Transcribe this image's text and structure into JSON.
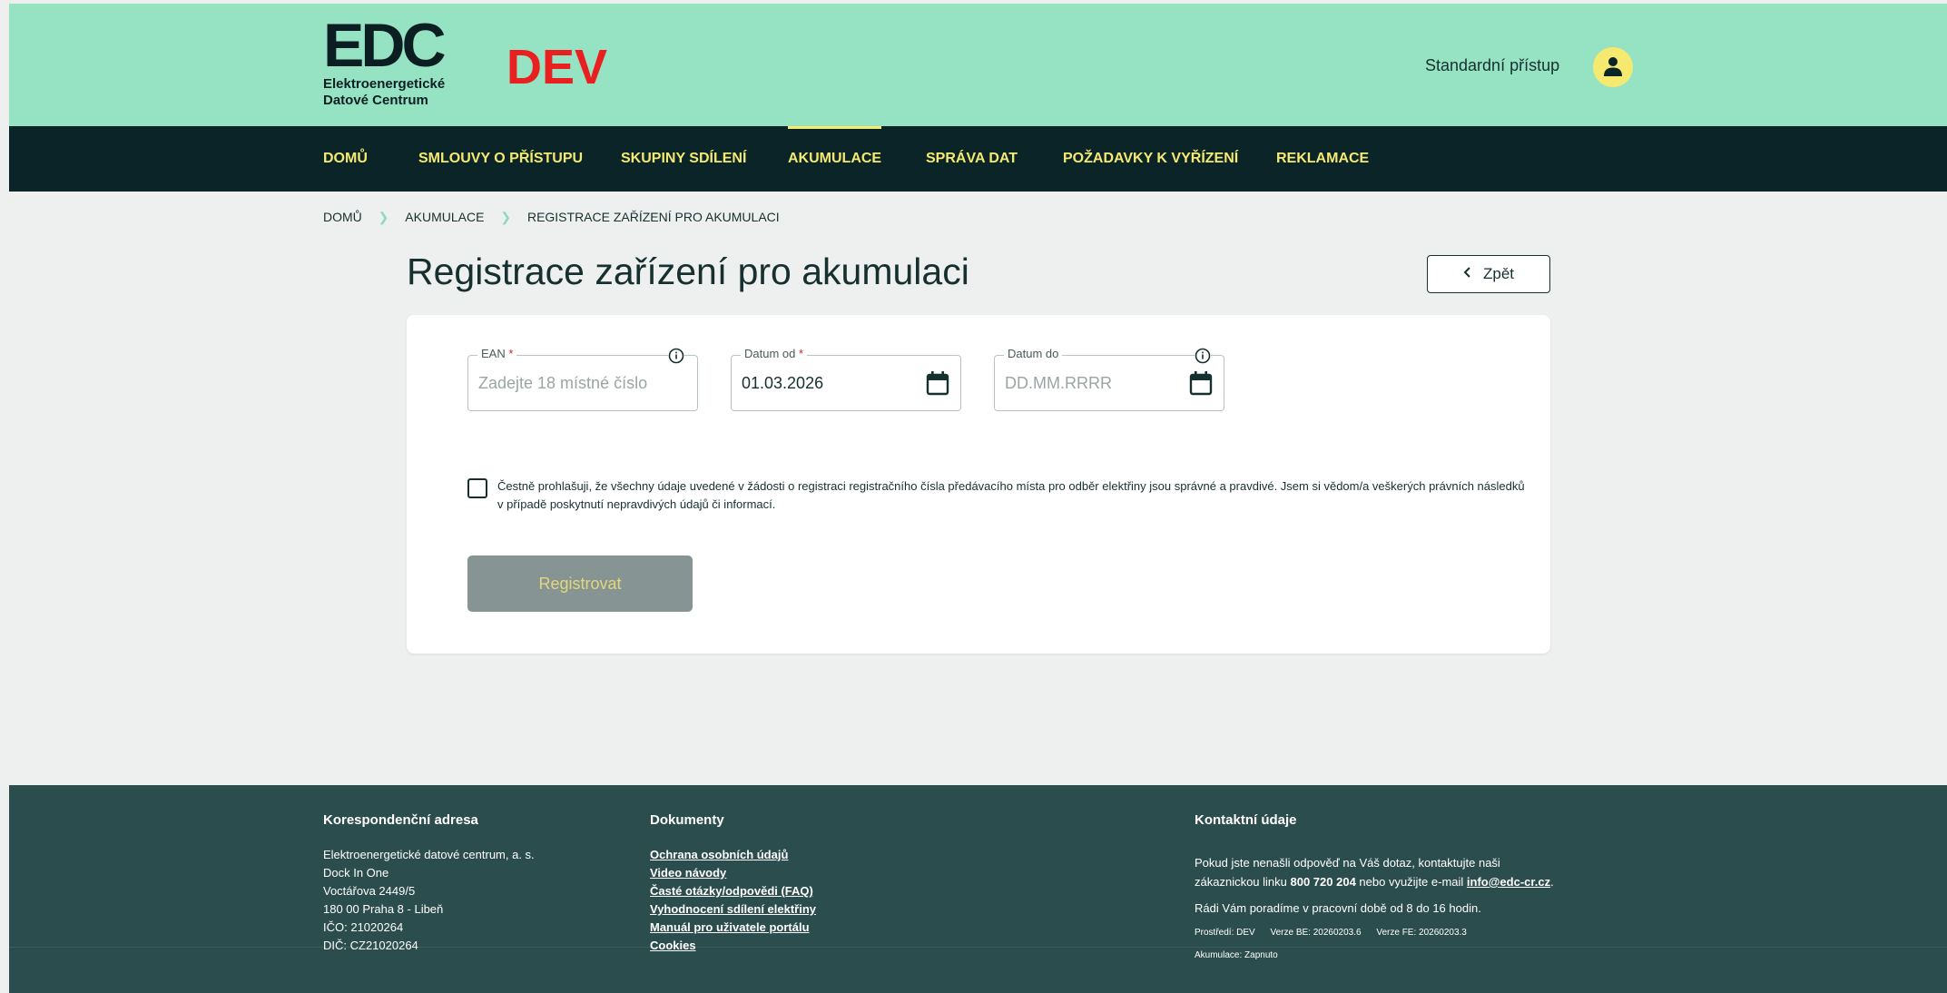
{
  "header": {
    "logo_mark": "EDC",
    "logo_text": "Elektroenergetické\nDatové Centrum",
    "env_label": "DEV",
    "user_label": "Standardní přístup"
  },
  "nav": {
    "items": [
      {
        "label": "DOMŮ"
      },
      {
        "label": "SMLOUVY O PŘÍSTUPU"
      },
      {
        "label": "SKUPINY SDÍLENÍ"
      },
      {
        "label": "AKUMULACE"
      },
      {
        "label": "SPRÁVA DAT"
      },
      {
        "label": "POŽADAVKY K VYŘÍZENÍ"
      },
      {
        "label": "REKLAMACE"
      }
    ],
    "active": "AKUMULACE"
  },
  "breadcrumb": [
    "DOMŮ",
    "AKUMULACE",
    "REGISTRACE ZAŘÍZENÍ PRO AKUMULACI"
  ],
  "page": {
    "title": "Registrace zařízení pro akumulaci",
    "back_label": "Zpět"
  },
  "form": {
    "ean": {
      "label": "EAN",
      "required_mark": "*",
      "placeholder": "Zadejte 18 místné číslo"
    },
    "date_from": {
      "label": "Datum od",
      "required_mark": "*",
      "value": "01.03.2026"
    },
    "date_to": {
      "label": "Datum do",
      "placeholder": "DD.MM.RRRR"
    },
    "consent_text": "Čestně prohlašuji, že všechny údaje uvedené v žádosti o registraci registračního čísla předávacího místa pro odběr elektřiny jsou správné a pravdivé. Jsem si vědom/a veškerých právních následků v případě poskytnutí nepravdivých údajů či informací.",
    "consent_checked": false,
    "submit_label": "Registrovat"
  },
  "footer": {
    "address": {
      "title": "Korespondenční adresa",
      "lines": [
        "Elektroenergetické datové centrum, a. s.",
        "Dock In One",
        "Voctářova 2449/5",
        "180 00 Praha 8 - Libeň",
        "IČO: 21020264",
        "DIČ: CZ21020264"
      ]
    },
    "documents": {
      "title": "Dokumenty",
      "links": [
        "Ochrana osobních údajů",
        "Video návody",
        "Časté otázky/odpovědi (FAQ)",
        "Vyhodnocení sdílení elektřiny",
        "Manuál pro uživatele portálu",
        "Cookies"
      ]
    },
    "contact": {
      "title": "Kontaktní údaje",
      "text_1a": "Pokud jste nenašli odpověď na Váš dotaz, kontaktujte naši",
      "text_1b": "zákaznickou linku ",
      "phone": "800 720 204",
      "text_1c": " nebo využijte e-mail ",
      "email": "info@edc-cr.cz",
      "text_1d": ".",
      "text_2": "Rádi Vám poradíme v pracovní době od 8 do 16 hodin.",
      "env": "Prostředí: DEV",
      "be_version": "Verze BE: 20260203.6",
      "fe_version": "Verze FE: 20260203.3",
      "accumulation": "Akumulace: Zapnuto"
    }
  },
  "colors": {
    "header_bg": "#96e3c4",
    "nav_bg": "#0a2428",
    "accent_yellow": "#f5ea6f",
    "footer_bg": "#2c4d4e",
    "dev_red": "#ea1f1f"
  }
}
